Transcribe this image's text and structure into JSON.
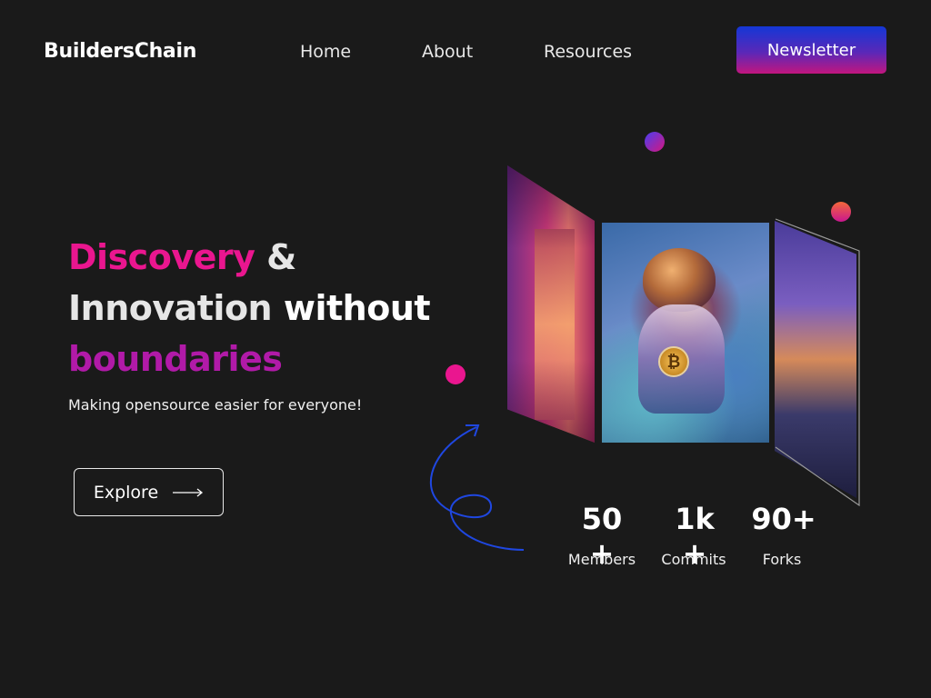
{
  "header": {
    "logo": "BuildersChain",
    "nav": [
      "Home",
      "About",
      "Resources"
    ],
    "newsletter_label": "Newsletter"
  },
  "hero": {
    "title": {
      "discovery": "Discovery",
      "amp": "&",
      "innovation": "Innovation",
      "without": "without",
      "boundaries": "boundaries"
    },
    "tagline": "Making opensource easier for everyone!",
    "explore_label": "Explore",
    "explore_icon": "arrow-right-icon"
  },
  "gallery": {
    "center_badge": "₿"
  },
  "stats": [
    {
      "value": "50 +",
      "label": "Members"
    },
    {
      "value": "1k +",
      "label": "Commits"
    },
    {
      "value": "90+",
      "label": "Forks"
    }
  ],
  "colors": {
    "background": "#1a1a1a",
    "accent_pink": "#ea168f",
    "accent_purple": "#b11aa8",
    "accent_blue": "#1437d6"
  }
}
